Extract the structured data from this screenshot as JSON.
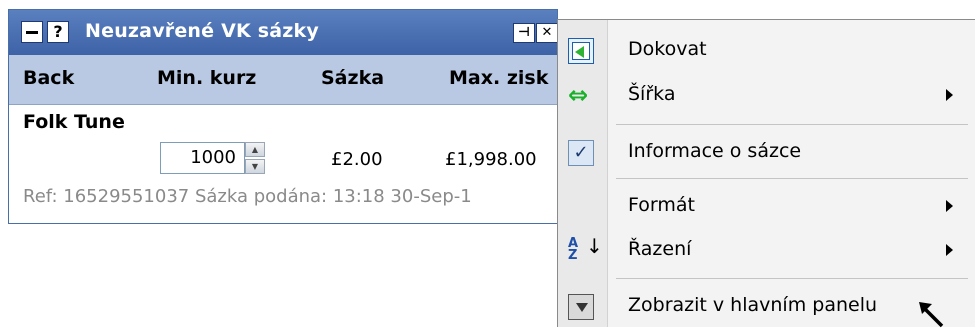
{
  "panel": {
    "title": "Neuzavřené VK sázky",
    "help_icon": "?",
    "columns": [
      "Back",
      "Min. kurz",
      "Sázka",
      "Max. zisk"
    ],
    "runner": "Folk Tune",
    "min_odds_value": "1000",
    "stake": "£2.00",
    "max_profit": "£1,998.00",
    "ref_line": "Ref: 16529551037   Sázka podána: 13:18  30-Sep-1"
  },
  "menu": {
    "items": [
      {
        "label": "Dokovat",
        "icon": "dock-icon"
      },
      {
        "label": "Šířka",
        "icon": "width-icon",
        "submenu": true
      },
      {
        "label": "Informace o sázce",
        "icon": "check-icon",
        "checked": true
      },
      {
        "label": "Formát",
        "submenu": true
      },
      {
        "label": "Řazení",
        "icon": "sort-az-icon",
        "submenu": true
      },
      {
        "label": "Zobrazit v hlavním panelu",
        "icon": "move-down-icon"
      }
    ]
  },
  "colors": {
    "titlebar": "#4a70b4",
    "header_row": "#b9c9e3",
    "menu_bg": "#f3f3f3",
    "accent_green": "#2fb335"
  }
}
